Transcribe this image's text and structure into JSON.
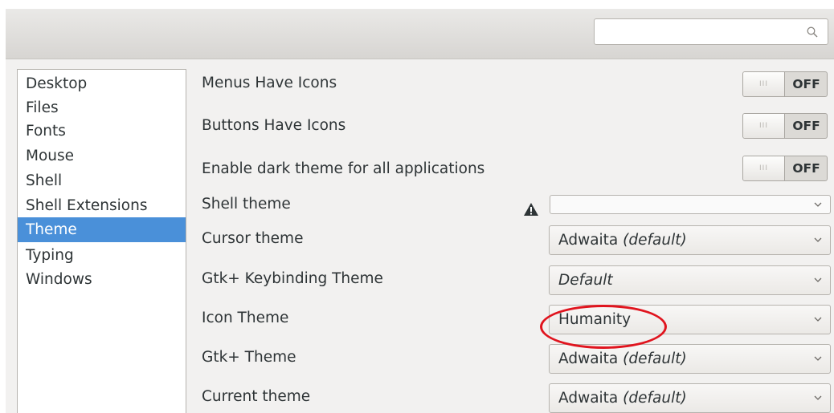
{
  "search": {
    "placeholder": ""
  },
  "sidebar": {
    "items": [
      {
        "label": "Desktop"
      },
      {
        "label": "Files"
      },
      {
        "label": "Fonts"
      },
      {
        "label": "Mouse"
      },
      {
        "label": "Shell"
      },
      {
        "label": "Shell Extensions"
      },
      {
        "label": "Theme",
        "selected": true
      },
      {
        "label": "Typing"
      },
      {
        "label": "Windows"
      }
    ]
  },
  "settings": {
    "menus_have_icons": {
      "label": "Menus Have Icons",
      "state": "OFF"
    },
    "buttons_have_icons": {
      "label": "Buttons Have Icons",
      "state": "OFF"
    },
    "dark_theme": {
      "label": "Enable dark theme for all applications",
      "state": "OFF"
    },
    "shell_theme": {
      "label": "Shell theme",
      "value": ""
    },
    "cursor_theme": {
      "label": "Cursor theme",
      "value": "Adwaita",
      "suffix": "(default)"
    },
    "keybinding_theme": {
      "label": "Gtk+ Keybinding Theme",
      "value": "Default"
    },
    "icon_theme": {
      "label": "Icon Theme",
      "value": "Humanity"
    },
    "gtk_theme": {
      "label": "Gtk+ Theme",
      "value": "Adwaita",
      "suffix": "(default)"
    },
    "current_theme": {
      "label": "Current theme",
      "value": "Adwaita",
      "suffix": "(default)"
    }
  },
  "switch_grip": "III",
  "colors": {
    "selection": "#4a90d9",
    "annotation": "#e0141e"
  }
}
